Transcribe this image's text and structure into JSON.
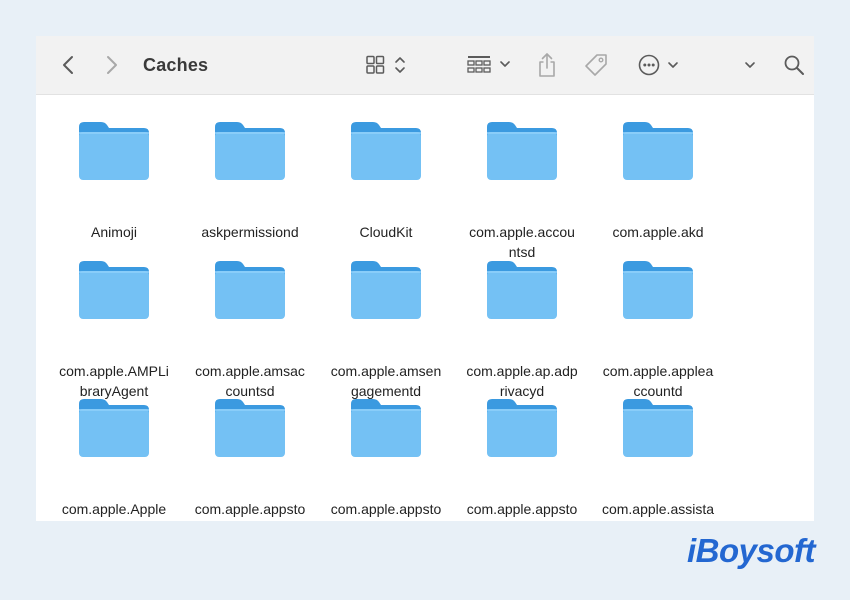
{
  "window": {
    "title": "Caches"
  },
  "toolbar": {
    "back_icon": "chevron-left-icon",
    "forward_icon": "chevron-right-icon",
    "view_icon": "icon-grid-view-icon",
    "group_icon": "group-by-icon",
    "share_icon": "share-icon",
    "tag_icon": "tag-icon",
    "more_icon": "ellipsis-circle-icon",
    "overflow_icon": "chevron-down-icon",
    "search_icon": "search-icon"
  },
  "folders": [
    {
      "name": "Animoji"
    },
    {
      "name": "askpermissiond"
    },
    {
      "name": "CloudKit"
    },
    {
      "name": "com.apple.accou\nntsd"
    },
    {
      "name": "com.apple.akd"
    },
    {
      "name": "com.apple.AMPLi\nbraryAgent"
    },
    {
      "name": "com.apple.amsac\ncountsd"
    },
    {
      "name": "com.apple.amsen\ngagementd"
    },
    {
      "name": "com.apple.ap.adp\nrivacyd"
    },
    {
      "name": "com.apple.applea\nccountd"
    },
    {
      "name": "com.apple.Apple\nMediaServices"
    },
    {
      "name": "com.apple.appsto\nre"
    },
    {
      "name": "com.apple.appsto\nreagent"
    },
    {
      "name": "com.apple.appsto\nrecomponentsd"
    },
    {
      "name": "com.apple.assista\nnt_cdmd"
    }
  ],
  "colors": {
    "folder_front": "#74c1f4",
    "folder_back": "#3b9ae0",
    "brand": "#2367d1"
  },
  "brand": {
    "text": "iBoysoft"
  }
}
